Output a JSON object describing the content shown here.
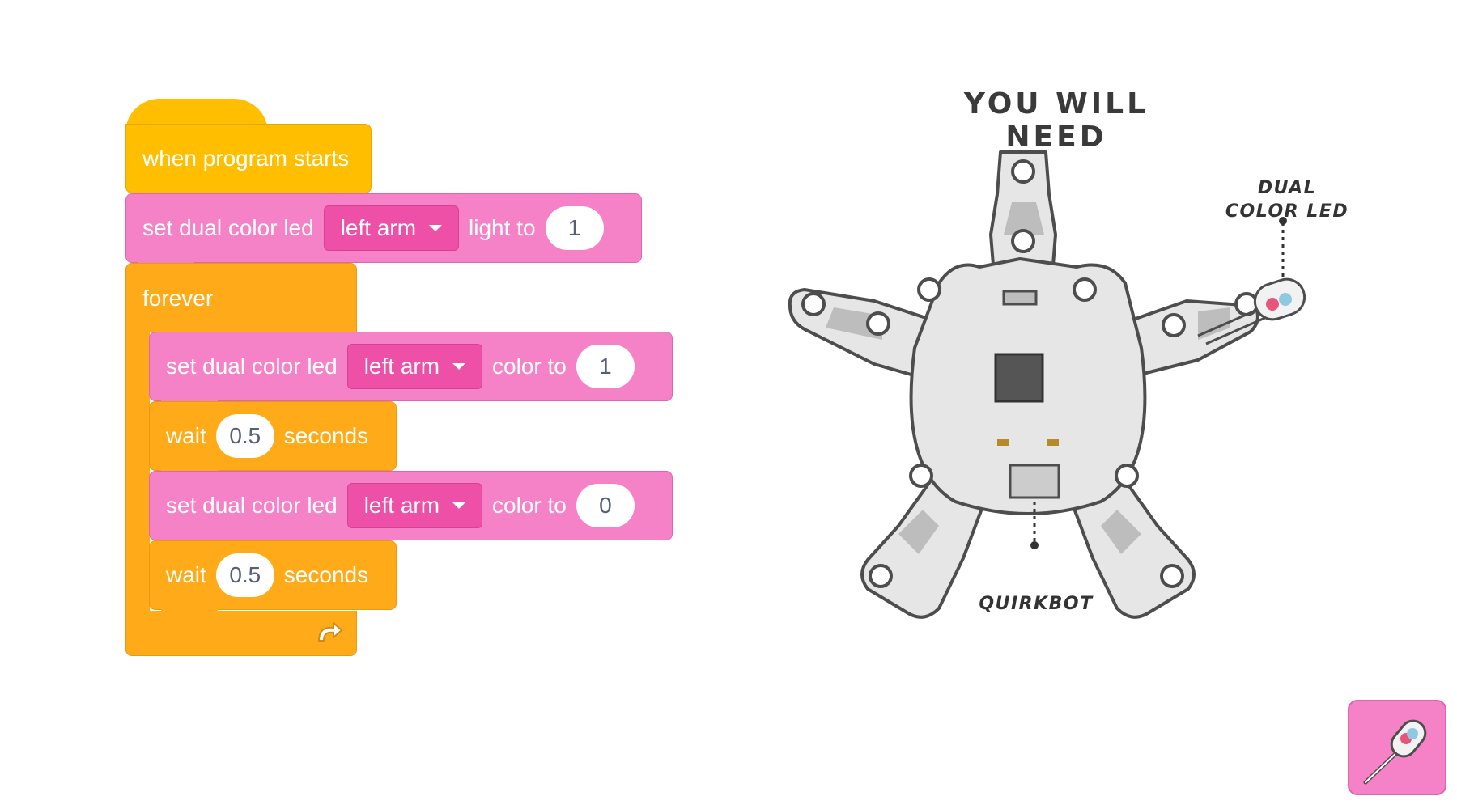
{
  "hat": {
    "label": "when program starts"
  },
  "setup": {
    "label": "set dual color led",
    "dropdown": "left arm",
    "mid": "light to",
    "value": "1"
  },
  "forever": {
    "label": "forever"
  },
  "loop": [
    {
      "label": "set dual color led",
      "dropdown": "left arm",
      "mid": "color to",
      "value": "1"
    },
    {
      "label": "wait",
      "value": "0.5",
      "suffix": "seconds"
    },
    {
      "label": "set dual color led",
      "dropdown": "left arm",
      "mid": "color to",
      "value": "0"
    },
    {
      "label": "wait",
      "value": "0.5",
      "suffix": "seconds"
    }
  ],
  "need": {
    "title": "YOU WILL NEED",
    "callout_led_line1": "DUAL",
    "callout_led_line2": "COLOR LED",
    "callout_board": "QUIRKBOT"
  },
  "colors": {
    "hat": "#ffbf00",
    "control": "#ffab19",
    "led_block": "#f582c6",
    "dropdown": "#ee4fa7",
    "board": "#e6e6e6",
    "board_outline": "#4d4d4d"
  },
  "icons": [
    "dropdown-caret-icon",
    "loop-arrow-icon",
    "dual-color-led-icon"
  ]
}
